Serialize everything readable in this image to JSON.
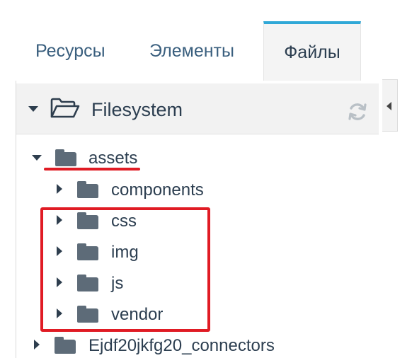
{
  "tabs": [
    {
      "label": "Ресурсы",
      "active": false
    },
    {
      "label": "Элементы",
      "active": false
    },
    {
      "label": "Файлы",
      "active": true
    }
  ],
  "panel": {
    "title": "Filesystem",
    "header_icon": "folder-open-icon",
    "refresh_icon": "refresh-icon",
    "collapse_icon": "caret-left-icon"
  },
  "tree": {
    "root": {
      "label": "assets",
      "expanded": true
    },
    "children": [
      {
        "label": "components",
        "expanded": false
      },
      {
        "label": "css",
        "expanded": false
      },
      {
        "label": "img",
        "expanded": false
      },
      {
        "label": "js",
        "expanded": false
      },
      {
        "label": "vendor",
        "expanded": false
      }
    ],
    "sibling": {
      "label": "Ejdf20jkfg20_connectors",
      "expanded": false
    }
  },
  "colors": {
    "tab_text": "#3a5f7e",
    "tab_active_border": "#30a8d7",
    "folder": "#5d6b78",
    "annotation_red": "#e01b24"
  }
}
